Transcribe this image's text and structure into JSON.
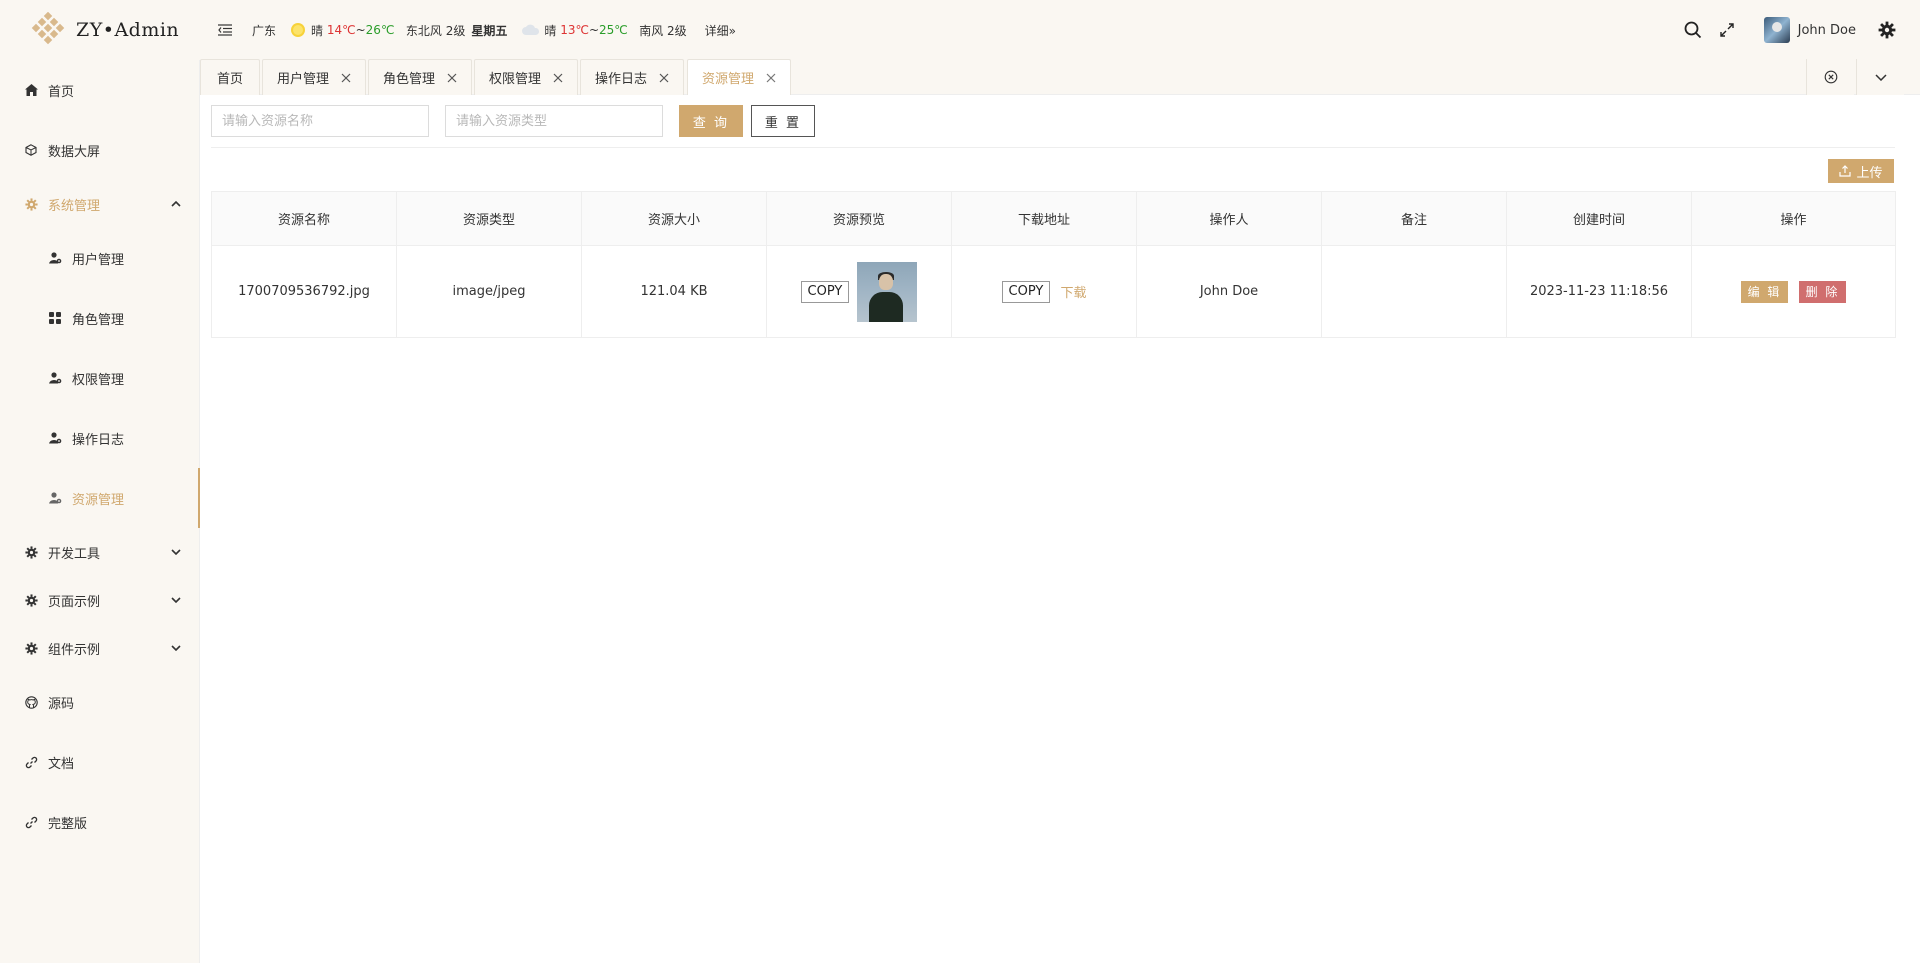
{
  "brand": {
    "name": "ZY•Admin"
  },
  "weather": {
    "city": "广东",
    "today_cond": "晴",
    "today_hi": "14℃",
    "today_sep": "~",
    "today_lo": "26℃",
    "today_wind": "东北风 2级",
    "today_weekday": "星期五",
    "tomorrow_cond": "晴",
    "tomorrow_hi": "13℃",
    "tomorrow_sep": "~",
    "tomorrow_lo": "25℃",
    "tomorrow_wind": "南风 2级",
    "detail": "详细»"
  },
  "user": {
    "name": "John Doe"
  },
  "sidebar": {
    "home": "首页",
    "dashboard": "数据大屏",
    "system": "系统管理",
    "users": "用户管理",
    "roles": "角色管理",
    "perms": "权限管理",
    "logs": "操作日志",
    "resources": "资源管理",
    "devtools": "开发工具",
    "pages": "页面示例",
    "components": "组件示例",
    "source": "源码",
    "docs": "文档",
    "full": "完整版"
  },
  "tabs": {
    "home": "首页",
    "users": "用户管理",
    "roles": "角色管理",
    "perms": "权限管理",
    "logs": "操作日志",
    "resources": "资源管理"
  },
  "search": {
    "name_placeholder": "请输入资源名称",
    "type_placeholder": "请输入资源类型",
    "query_label": "查 询",
    "reset_label": "重 置"
  },
  "upload_label": "上传",
  "table": {
    "headers": [
      "资源名称",
      "资源类型",
      "资源大小",
      "资源预览",
      "下载地址",
      "操作人",
      "备注",
      "创建时间",
      "操作"
    ],
    "row": {
      "name": "1700709536792.jpg",
      "type": "image/jpeg",
      "size": "121.04 KB",
      "copy": "COPY",
      "copy2": "COPY",
      "download": "下载",
      "operator": "John Doe",
      "remark": "",
      "created": "2023-11-23 11:18:56",
      "edit": "编 辑",
      "delete": "删 除"
    }
  },
  "colors": {
    "accent": "#d0a86e",
    "danger": "#d06e6e",
    "sidebar_bg": "#faf7f2"
  }
}
